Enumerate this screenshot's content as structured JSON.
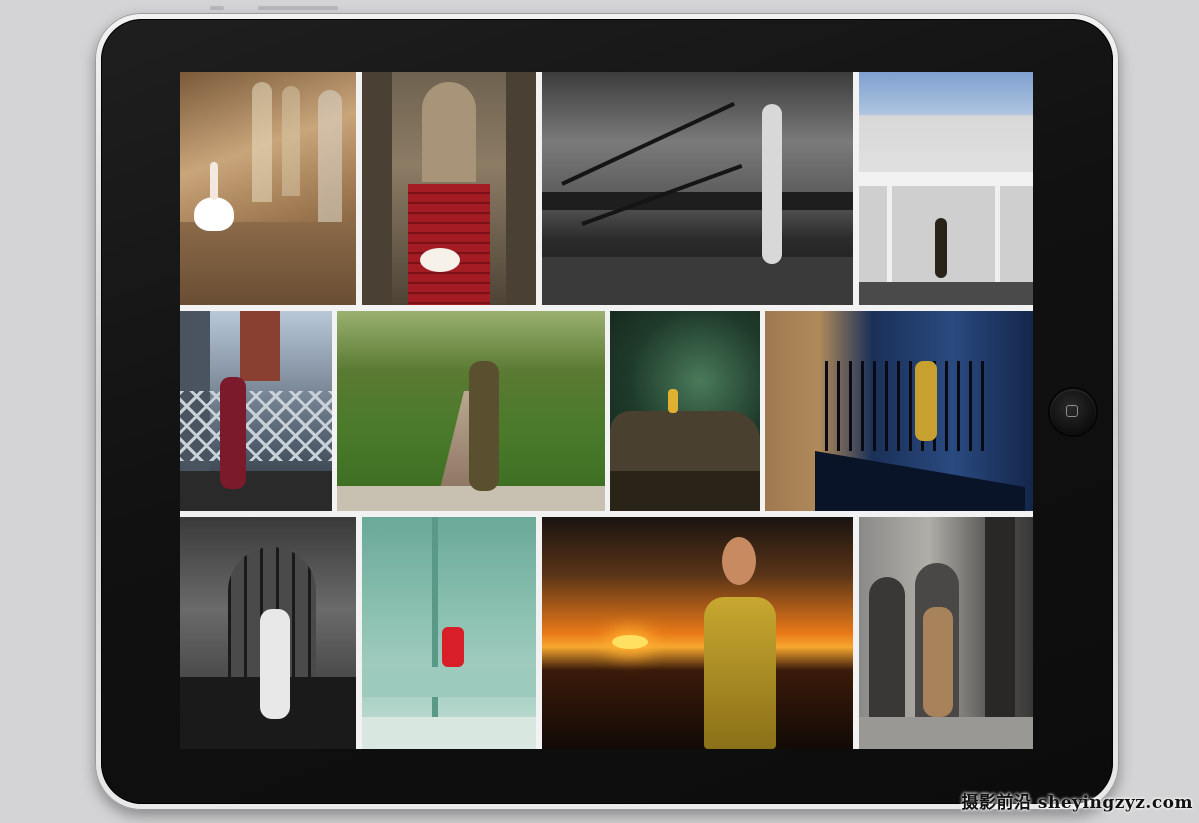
{
  "device": {
    "type": "tablet",
    "home_button_icon": "home-square-icon"
  },
  "gallery": {
    "photos": [
      {
        "id": "ballerina-gothic-staircase",
        "tone": "warm"
      },
      {
        "id": "ballerina-red-carpet-stairs",
        "tone": "warm-red"
      },
      {
        "id": "woman-railing-black-and-white-seafront",
        "tone": "monochrome"
      },
      {
        "id": "woman-art-deco-house",
        "tone": "cool"
      },
      {
        "id": "woman-steel-bridge",
        "tone": "cool"
      },
      {
        "id": "woman-tree-avenue",
        "tone": "green"
      },
      {
        "id": "woman-forest-rocks-night",
        "tone": "green-dark"
      },
      {
        "id": "woman-blue-stairwell",
        "tone": "blue"
      },
      {
        "id": "woman-gothic-window-monochrome",
        "tone": "monochrome"
      },
      {
        "id": "woman-red-coat-mint-room",
        "tone": "mint"
      },
      {
        "id": "woman-gold-dress-sunset",
        "tone": "orange"
      },
      {
        "id": "woman-fur-coat-stone-arches",
        "tone": "grey"
      }
    ]
  },
  "watermark": {
    "text": "摄影前沿 sheyingzyz.com"
  },
  "colors": {
    "bezel": "#111111",
    "frame": "#e6e6e6",
    "background": "#d4d4d6",
    "gallery_gap": "#f2f2f2"
  }
}
